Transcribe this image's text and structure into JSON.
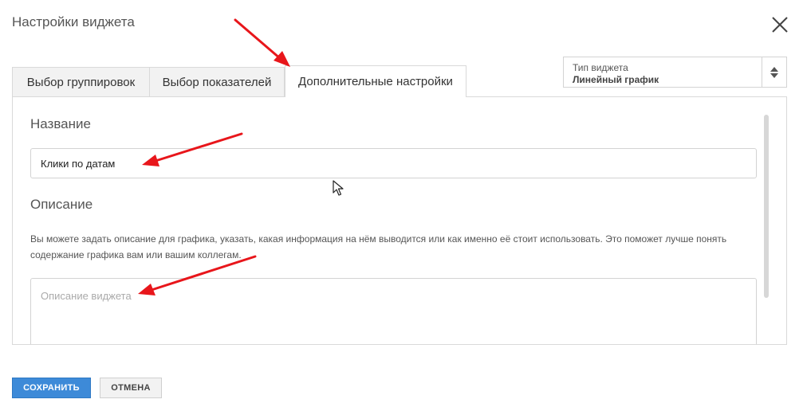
{
  "dialog": {
    "title": "Настройки виджета"
  },
  "tabs": [
    {
      "label": "Выбор группировок",
      "active": false
    },
    {
      "label": "Выбор показателей",
      "active": false
    },
    {
      "label": "Дополнительные настройки",
      "active": true
    }
  ],
  "widget_type": {
    "label": "Тип виджета",
    "value": "Линейный график"
  },
  "name_section": {
    "title": "Название",
    "value": "Клики по датам"
  },
  "description_section": {
    "title": "Описание",
    "help": "Вы можете задать описание для графика, указать, какая информация на нём выводится или как именно её стоит использовать. Это поможет лучше понять содержание графика вам или вашим коллегам.",
    "placeholder": "Описание виджета"
  },
  "buttons": {
    "save": "СОХРАНИТЬ",
    "cancel": "ОТМЕНА"
  },
  "colors": {
    "accent": "#3d8ad8",
    "annotation": "#e8161b",
    "border": "#d9d9d9"
  },
  "icons": [
    "close-icon",
    "sort-arrows-icon",
    "mouse-cursor-icon",
    "annotation-arrow-icon"
  ]
}
